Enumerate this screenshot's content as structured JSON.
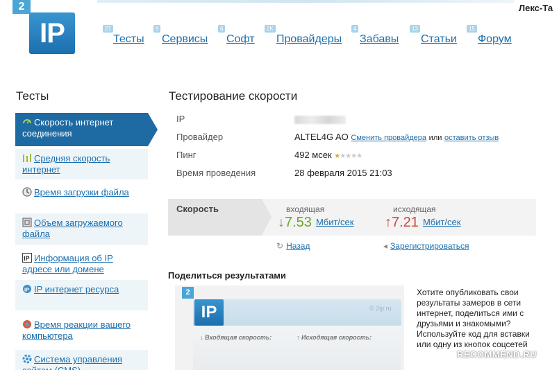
{
  "logo": {
    "badge": "2",
    "text": "IP"
  },
  "user": {
    "name": "Лекс-Та"
  },
  "nav": {
    "items": [
      {
        "label": "Тесты",
        "badge": "27"
      },
      {
        "label": "Сервисы",
        "badge": "9"
      },
      {
        "label": "Софт",
        "badge": "6"
      },
      {
        "label": "Провайдеры",
        "badge": "2K"
      },
      {
        "label": "Забавы",
        "badge": "4"
      },
      {
        "label": "Статьи",
        "badge": "13"
      },
      {
        "label": "Форум",
        "badge": "15"
      }
    ]
  },
  "sidebar": {
    "title": "Тесты",
    "items": [
      {
        "label": "Скорость интернет соединения",
        "icon": "speed-icon"
      },
      {
        "label": "Средняя скорость интернет",
        "icon": "bars-icon"
      },
      {
        "label": "Время загрузки файла",
        "icon": "clock-icon"
      },
      {
        "label": "Объем загружаемого файла",
        "icon": "file-icon"
      },
      {
        "label": "Информация об IP адресе или домене",
        "icon": "ip-info-icon"
      },
      {
        "label": "IP интернет ресурса",
        "icon": "ip-resource-icon"
      },
      {
        "label": "Время реакции вашего компьютера",
        "icon": "reaction-icon"
      },
      {
        "label": "Система управления сайтом (CMS)",
        "icon": "cms-icon"
      }
    ]
  },
  "main": {
    "title": "Тестирование скорости",
    "info": {
      "ip_label": "IP",
      "provider_label": "Провайдер",
      "provider_value": "ALTEL4G AO",
      "change_provider": "Сменить провайдера",
      "or_text": "или",
      "leave_review": "оставить отзыв",
      "ping_label": "Пинг",
      "ping_value": "492 мсек",
      "ping_rating": 1,
      "time_label": "Время проведения",
      "time_value": "28 февраля 2015 21:03"
    },
    "speed": {
      "label": "Скорость",
      "in_label": "входящая",
      "in_value": "7.53",
      "in_arrow": "↓",
      "out_label": "исходящая",
      "out_value": "7.21",
      "out_arrow": "↑",
      "unit": "Мбит/сек"
    },
    "links": {
      "back": "Назад",
      "register": "Зарегистрироваться"
    },
    "share": {
      "title": "Поделиться результатами",
      "widget_badge": "2",
      "widget_logo": "IP",
      "widget_site": "© 2ip.ru",
      "widget_in": "↓ Входящая скорость:",
      "widget_out": "↑ Исходящая скорость:",
      "text": "Хотите опубликовать свои результаты замеров в сети интернет, поделиться ими с друзьями и знакомыми? Используйте код для вставки или одну из кнопок соцсетей"
    }
  },
  "watermark": "RECOMMEND.RU",
  "colors": {
    "accent": "#1e6aa3",
    "link": "#1b6fae",
    "down": "#6aa52b",
    "up": "#c84a3a"
  }
}
